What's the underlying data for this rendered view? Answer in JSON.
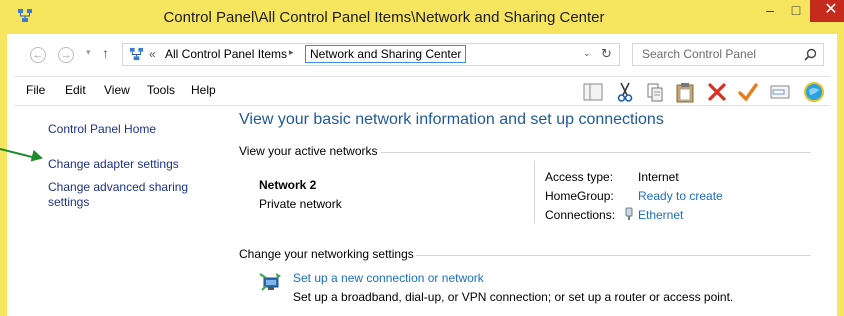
{
  "window": {
    "title": "Control Panel\\All Control Panel Items\\Network and Sharing Center",
    "minimize": "–",
    "maximize": "□",
    "close": "✕"
  },
  "address": {
    "back": "←",
    "forward": "→",
    "dropdown": "▾",
    "up": "↑",
    "chevron": "«",
    "crumbs": [
      "All Control Panel Items",
      "Network and Sharing Center"
    ],
    "separator": "▸",
    "addr_dropdown": "⌄",
    "refresh": "↻",
    "search_placeholder": "Search Control Panel"
  },
  "menu": [
    "File",
    "Edit",
    "View",
    "Tools",
    "Help"
  ],
  "toolbar_icons": [
    "pane-icon",
    "cut-icon",
    "copy-icon",
    "paste-icon",
    "delete-icon",
    "checkmark-icon",
    "properties-icon",
    "globe-icon"
  ],
  "left_pane": {
    "home": "Control Panel Home",
    "adapter": "Change adapter settings",
    "advanced_line1": "Change advanced sharing",
    "advanced_line2": "settings"
  },
  "main": {
    "title": "View your basic network information and set up connections",
    "active_networks": "View your active networks",
    "network_name": "Network  2",
    "network_type": "Private network",
    "access_type_label": "Access type:",
    "access_type_value": "Internet",
    "homegroup_label": "HomeGroup:",
    "homegroup_value": "Ready to create",
    "connections_label": "Connections:",
    "connections_value": "Ethernet",
    "change_settings": "Change your networking settings",
    "setup_link": "Set up a new connection or network",
    "setup_desc": "Set up a broadband, dial-up, or VPN connection; or set up a router or access point."
  },
  "colors": {
    "title_bar": "#f7e55f",
    "link": "#1a6fc7",
    "heading": "#1e5a9a",
    "close_button": "#c42b1c",
    "annotation_arrow": "#1a8a2a"
  }
}
